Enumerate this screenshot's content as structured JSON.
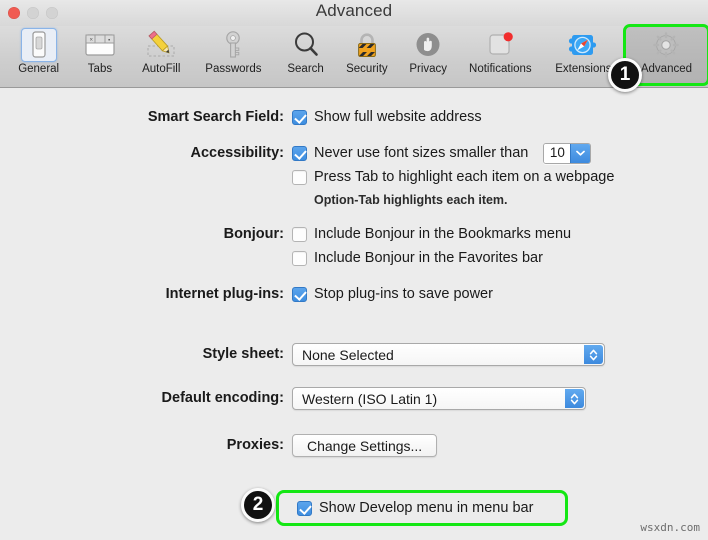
{
  "window": {
    "title": "Advanced",
    "traffic_lights": [
      "close",
      "minimize",
      "zoom"
    ]
  },
  "toolbar": {
    "items": [
      {
        "label": "General",
        "icon": "general-icon",
        "selected": true,
        "active": false
      },
      {
        "label": "Tabs",
        "icon": "tabs-icon",
        "selected": false,
        "active": false
      },
      {
        "label": "AutoFill",
        "icon": "autofill-icon",
        "selected": false,
        "active": false
      },
      {
        "label": "Passwords",
        "icon": "passwords-key-icon",
        "selected": false,
        "active": false
      },
      {
        "label": "Search",
        "icon": "search-magnifier-icon",
        "selected": false,
        "active": false
      },
      {
        "label": "Security",
        "icon": "security-lock-icon",
        "selected": false,
        "active": false
      },
      {
        "label": "Privacy",
        "icon": "privacy-hand-icon",
        "selected": false,
        "active": false
      },
      {
        "label": "Notifications",
        "icon": "notifications-icon",
        "selected": false,
        "active": false
      },
      {
        "label": "Extensions",
        "icon": "extensions-icon",
        "selected": false,
        "active": false
      },
      {
        "label": "Advanced",
        "icon": "advanced-gear-icon",
        "selected": false,
        "active": true
      }
    ]
  },
  "annotations": {
    "badge_1": "1",
    "badge_2": "2",
    "highlight_color": "#14e714"
  },
  "settings": {
    "smart_search_field": {
      "label": "Smart Search Field:",
      "show_full_address": {
        "text": "Show full website address",
        "checked": true
      }
    },
    "accessibility": {
      "label": "Accessibility:",
      "never_use_font_sizes": {
        "text": "Never use font sizes smaller than",
        "checked": true
      },
      "font_size_value": "10",
      "press_tab": {
        "text": "Press Tab to highlight each item on a webpage",
        "checked": false
      },
      "hint": "Option-Tab highlights each item."
    },
    "bonjour": {
      "label": "Bonjour:",
      "bookmarks_menu": {
        "text": "Include Bonjour in the Bookmarks menu",
        "checked": false
      },
      "favorites_bar": {
        "text": "Include Bonjour in the Favorites bar",
        "checked": false
      }
    },
    "internet_plugins": {
      "label": "Internet plug-ins:",
      "stop_plugins": {
        "text": "Stop plug-ins to save power",
        "checked": true
      }
    },
    "style_sheet": {
      "label": "Style sheet:",
      "value": "None Selected"
    },
    "default_encoding": {
      "label": "Default encoding:",
      "value": "Western (ISO Latin 1)"
    },
    "proxies": {
      "label": "Proxies:",
      "button_label": "Change Settings..."
    },
    "develop_menu": {
      "text": "Show Develop menu in menu bar",
      "checked": true
    }
  },
  "watermark": "wsxdn.com"
}
